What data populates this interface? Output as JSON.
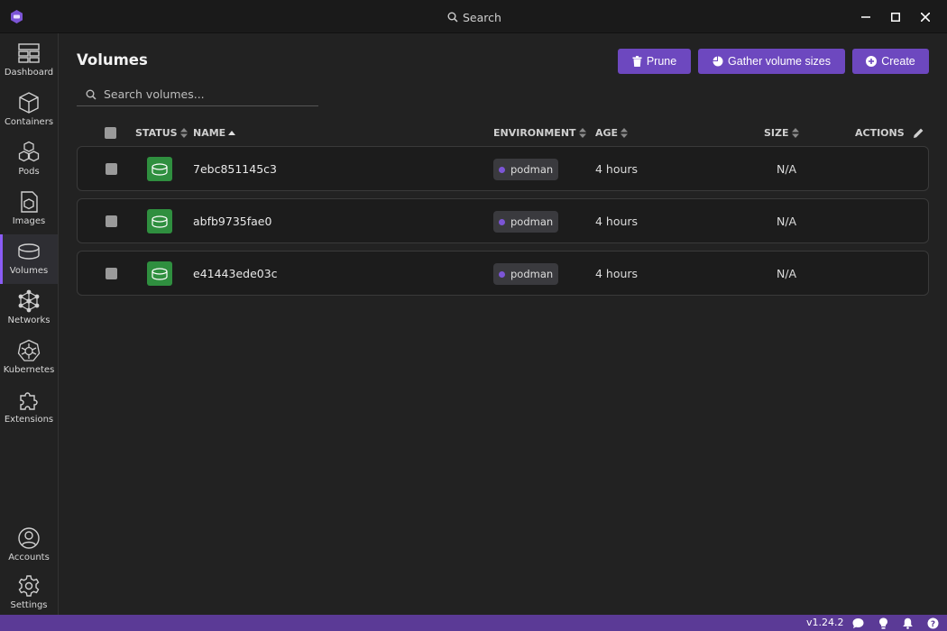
{
  "titlebar": {
    "search_label": "Search"
  },
  "sidebar": {
    "items": [
      {
        "label": "Dashboard",
        "icon": "dashboard-icon"
      },
      {
        "label": "Containers",
        "icon": "cube-icon"
      },
      {
        "label": "Pods",
        "icon": "pods-icon"
      },
      {
        "label": "Images",
        "icon": "image-icon"
      },
      {
        "label": "Volumes",
        "icon": "volume-icon",
        "active": true
      },
      {
        "label": "Networks",
        "icon": "network-icon"
      },
      {
        "label": "Kubernetes",
        "icon": "kubernetes-icon"
      },
      {
        "label": "Extensions",
        "icon": "puzzle-icon"
      }
    ],
    "bottom": [
      {
        "label": "Accounts",
        "icon": "account-icon"
      },
      {
        "label": "Settings",
        "icon": "gear-icon"
      }
    ]
  },
  "main": {
    "title": "Volumes",
    "buttons": {
      "prune": "Prune",
      "gather": "Gather volume sizes",
      "create": "Create"
    },
    "search": {
      "placeholder": "Search volumes..."
    },
    "table": {
      "headers": {
        "status": "STATUS",
        "name": "NAME",
        "environment": "ENVIRONMENT",
        "age": "AGE",
        "size": "SIZE",
        "actions": "ACTIONS"
      },
      "rows": [
        {
          "name": "7ebc851145c3",
          "environment": "podman",
          "age": "4 hours",
          "size": "N/A"
        },
        {
          "name": "abfb9735fae0",
          "environment": "podman",
          "age": "4 hours",
          "size": "N/A"
        },
        {
          "name": "e41443ede03c",
          "environment": "podman",
          "age": "4 hours",
          "size": "N/A"
        }
      ]
    }
  },
  "statusbar": {
    "version": "v1.24.2"
  },
  "colors": {
    "accent": "#6d48bf",
    "statusbar": "#5b3a96",
    "status_ok": "#2f8f3f"
  }
}
